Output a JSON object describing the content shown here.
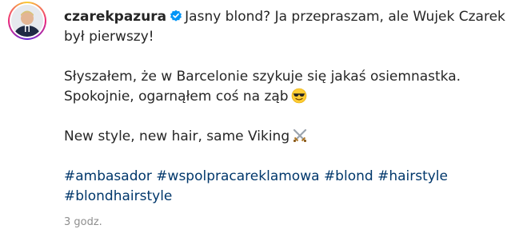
{
  "post": {
    "username": "czarekpazura",
    "verified": true,
    "caption_first": "Jasny blond? Ja przepraszam, ale Wujek Czarek",
    "caption_first_cont": "był pierwszy!",
    "para2_line1": "Słyszałem, że w Barcelonie szykuje się jakaś osiemnastka.",
    "para2_line2": "Spokojnie, ogarnąłem coś na ząb",
    "para2_emoji": "smiling-face-with-sunglasses-icon",
    "para3": "New style, new hair, same Viking",
    "para3_emoji": "crossed-swords-icon",
    "hashtags": [
      "#ambasador",
      "#wspolpracareklamowa",
      "#blond",
      "#hairstyle",
      "#blondhairstyle"
    ],
    "timestamp": "3 godz."
  },
  "colors": {
    "text": "#262626",
    "hashtag": "#00376b",
    "verified": "#0095f6",
    "muted": "#8e8e8e"
  }
}
